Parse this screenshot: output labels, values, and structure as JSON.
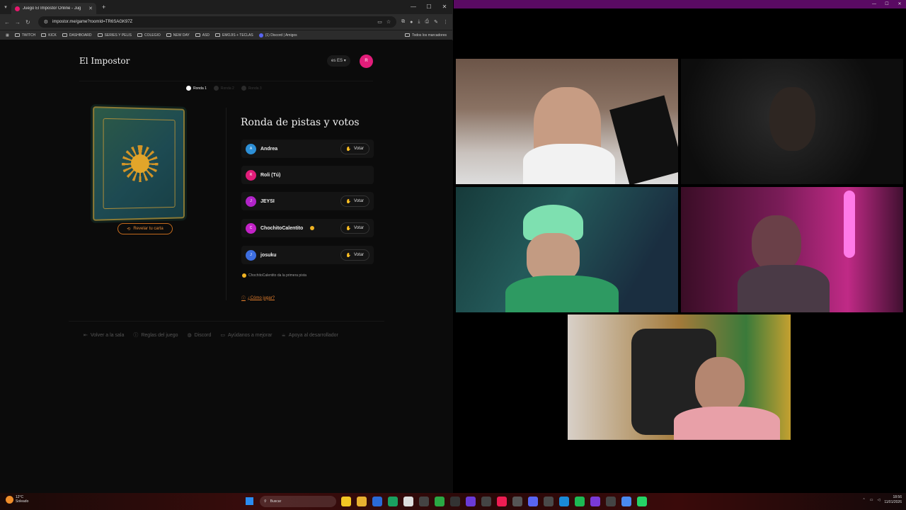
{
  "browser": {
    "tab_title": "Juego El Impostor Online - Jug",
    "url": "impostor.me/game?roomId=TR6SAGK97Z",
    "bookmarks": [
      "TWITCH",
      "KICK",
      "DASHBOARD",
      "SERIES Y PELIS",
      "COLEGIO",
      "NEW DAY",
      "ASD",
      "EMOJIS + TECLAS",
      "(1) Discord | Amigos"
    ],
    "bookmarks_right": "Todos los marcadores"
  },
  "site": {
    "title": "El Impostor",
    "language": "ES",
    "language_code": "es",
    "user_initial": "R"
  },
  "steps": [
    {
      "label": "Ronda 1",
      "active": true
    },
    {
      "label": "Ronda 2",
      "active": false
    },
    {
      "label": "Ronda 3",
      "active": false
    }
  ],
  "reveal_card_label": "Revelar tu carta",
  "round_title": "Ronda de pistas y votos",
  "vote_label": "Votar",
  "players": [
    {
      "initial": "A",
      "name": "Andrea",
      "color": "#2d8fd6",
      "can_vote": true,
      "turn": false
    },
    {
      "initial": "R",
      "name": "Roli (Tú)",
      "color": "#e21d7a",
      "can_vote": false,
      "turn": false
    },
    {
      "initial": "J",
      "name": "JEYSI",
      "color": "#b224c9",
      "can_vote": true,
      "turn": false
    },
    {
      "initial": "C",
      "name": "ChochitoCalentito",
      "color": "#c322c7",
      "can_vote": true,
      "turn": true
    },
    {
      "initial": "J",
      "name": "josuku",
      "color": "#3d6ee0",
      "can_vote": true,
      "turn": false
    }
  ],
  "hint_text": "ChochitoCalentito da la primera pista",
  "howto_label": "¿Cómo jugar?",
  "footer_links": [
    "Volver a la sala",
    "Reglas del juego",
    "Discord",
    "Ayúdanos a mejorar",
    "Apoya al desarrollador"
  ],
  "taskbar": {
    "temperature": "12°C",
    "weather": "Soleado",
    "search_placeholder": "Buscar",
    "time": "18:56",
    "date": "11/01/2026"
  }
}
